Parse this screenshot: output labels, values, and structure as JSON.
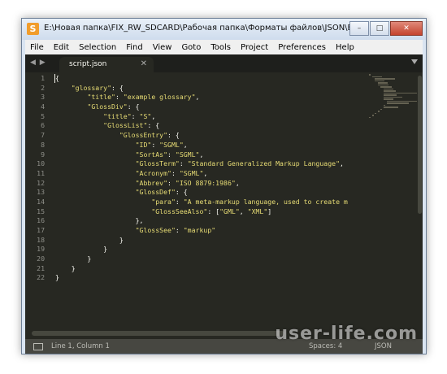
{
  "window": {
    "app_icon_glyph": "S",
    "title": "E:\\Новая папка\\FIX_RW_SDCARD\\Рабочая папка\\Форматы файлов\\JSON\\Example\\script.json..."
  },
  "window_controls": {
    "minimize": "–",
    "maximize": "□",
    "close": "✕"
  },
  "menu": [
    "File",
    "Edit",
    "Selection",
    "Find",
    "View",
    "Goto",
    "Tools",
    "Project",
    "Preferences",
    "Help"
  ],
  "tabs": {
    "nav": "◀ ▶",
    "active_title": "script.json",
    "close_glyph": "✕"
  },
  "editor": {
    "line_numbers": [
      "1",
      "2",
      "3",
      "4",
      "5",
      "6",
      "7",
      "8",
      "9",
      "10",
      "11",
      "12",
      "13",
      "14",
      "15",
      "16",
      "17",
      "18",
      "19",
      "20",
      "21",
      "22"
    ],
    "lines": [
      [
        {
          "t": "{",
          "c": "k"
        }
      ],
      [
        {
          "t": "    ",
          "c": "k"
        },
        {
          "t": "\"glossary\"",
          "c": "s"
        },
        {
          "t": ": {",
          "c": "k"
        }
      ],
      [
        {
          "t": "        ",
          "c": "k"
        },
        {
          "t": "\"title\"",
          "c": "s"
        },
        {
          "t": ": ",
          "c": "k"
        },
        {
          "t": "\"example glossary\"",
          "c": "s"
        },
        {
          "t": ",",
          "c": "k"
        }
      ],
      [
        {
          "t": "        ",
          "c": "k"
        },
        {
          "t": "\"GlossDiv\"",
          "c": "s"
        },
        {
          "t": ": {",
          "c": "k"
        }
      ],
      [
        {
          "t": "            ",
          "c": "k"
        },
        {
          "t": "\"title\"",
          "c": "s"
        },
        {
          "t": ": ",
          "c": "k"
        },
        {
          "t": "\"S\"",
          "c": "s"
        },
        {
          "t": ",",
          "c": "k"
        }
      ],
      [
        {
          "t": "            ",
          "c": "k"
        },
        {
          "t": "\"GlossList\"",
          "c": "s"
        },
        {
          "t": ": {",
          "c": "k"
        }
      ],
      [
        {
          "t": "                ",
          "c": "k"
        },
        {
          "t": "\"GlossEntry\"",
          "c": "s"
        },
        {
          "t": ": {",
          "c": "k"
        }
      ],
      [
        {
          "t": "                    ",
          "c": "k"
        },
        {
          "t": "\"ID\"",
          "c": "s"
        },
        {
          "t": ": ",
          "c": "k"
        },
        {
          "t": "\"SGML\"",
          "c": "s"
        },
        {
          "t": ",",
          "c": "k"
        }
      ],
      [
        {
          "t": "                    ",
          "c": "k"
        },
        {
          "t": "\"SortAs\"",
          "c": "s"
        },
        {
          "t": ": ",
          "c": "k"
        },
        {
          "t": "\"SGML\"",
          "c": "s"
        },
        {
          "t": ",",
          "c": "k"
        }
      ],
      [
        {
          "t": "                    ",
          "c": "k"
        },
        {
          "t": "\"GlossTerm\"",
          "c": "s"
        },
        {
          "t": ": ",
          "c": "k"
        },
        {
          "t": "\"Standard Generalized Markup Language\"",
          "c": "s"
        },
        {
          "t": ",",
          "c": "k"
        }
      ],
      [
        {
          "t": "                    ",
          "c": "k"
        },
        {
          "t": "\"Acronym\"",
          "c": "s"
        },
        {
          "t": ": ",
          "c": "k"
        },
        {
          "t": "\"SGML\"",
          "c": "s"
        },
        {
          "t": ",",
          "c": "k"
        }
      ],
      [
        {
          "t": "                    ",
          "c": "k"
        },
        {
          "t": "\"Abbrev\"",
          "c": "s"
        },
        {
          "t": ": ",
          "c": "k"
        },
        {
          "t": "\"ISO 8879:1986\"",
          "c": "s"
        },
        {
          "t": ",",
          "c": "k"
        }
      ],
      [
        {
          "t": "                    ",
          "c": "k"
        },
        {
          "t": "\"GlossDef\"",
          "c": "s"
        },
        {
          "t": ": {",
          "c": "k"
        }
      ],
      [
        {
          "t": "                        ",
          "c": "k"
        },
        {
          "t": "\"para\"",
          "c": "s"
        },
        {
          "t": ": ",
          "c": "k"
        },
        {
          "t": "\"A meta-markup language, used to create m",
          "c": "s"
        }
      ],
      [
        {
          "t": "                        ",
          "c": "k"
        },
        {
          "t": "\"GlossSeeAlso\"",
          "c": "s"
        },
        {
          "t": ": [",
          "c": "k"
        },
        {
          "t": "\"GML\"",
          "c": "s"
        },
        {
          "t": ", ",
          "c": "k"
        },
        {
          "t": "\"XML\"",
          "c": "s"
        },
        {
          "t": "]",
          "c": "k"
        }
      ],
      [
        {
          "t": "                    },",
          "c": "k"
        }
      ],
      [
        {
          "t": "                    ",
          "c": "k"
        },
        {
          "t": "\"GlossSee\"",
          "c": "s"
        },
        {
          "t": ": ",
          "c": "k"
        },
        {
          "t": "\"markup\"",
          "c": "s"
        }
      ],
      [
        {
          "t": "                }",
          "c": "k"
        }
      ],
      [
        {
          "t": "            }",
          "c": "k"
        }
      ],
      [
        {
          "t": "        }",
          "c": "k"
        }
      ],
      [
        {
          "t": "    }",
          "c": "k"
        }
      ],
      [
        {
          "t": "}",
          "c": "k"
        }
      ]
    ]
  },
  "status": {
    "position": "Line 1, Column 1",
    "spaces": "Spaces: 4",
    "syntax": "JSON"
  },
  "watermark": "user-life.com",
  "colors": {
    "editor_bg": "#272822",
    "string": "#e6db74",
    "text": "#f8f8f2",
    "line_number": "#8f908a"
  }
}
